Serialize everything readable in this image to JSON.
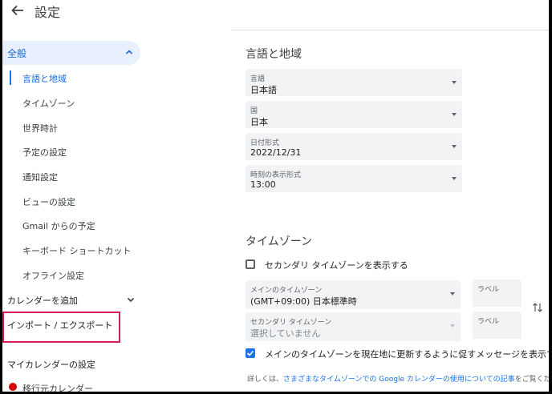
{
  "header": {
    "title": "設定",
    "back_icon": "arrow-back-icon"
  },
  "sidebar": {
    "general_label": "全般",
    "items": [
      {
        "label": "言語と地域",
        "active": true
      },
      {
        "label": "タイムゾーン"
      },
      {
        "label": "世界時計"
      },
      {
        "label": "予定の設定"
      },
      {
        "label": "通知設定"
      },
      {
        "label": "ビューの設定"
      },
      {
        "label": "Gmail からの予定"
      },
      {
        "label": "キーボード ショートカット"
      },
      {
        "label": "オフライン設定"
      }
    ],
    "add_calendar": "カレンダーを追加",
    "import_export": "インポート / エクスポート",
    "my_calendars": "マイカレンダーの設定",
    "migrate_calendar": "移行元カレンダー",
    "accent_color": "#1a73e8",
    "highlight_color": "#d81b60",
    "calendar_dot_color": "#d50000"
  },
  "language_region": {
    "title": "言語と地域",
    "fields": [
      {
        "label": "言語",
        "value": "日本語"
      },
      {
        "label": "国",
        "value": "日本"
      },
      {
        "label": "日付形式",
        "value": "2022/12/31"
      },
      {
        "label": "時刻の表示形式",
        "value": "13:00"
      }
    ]
  },
  "timezone": {
    "title": "タイムゾーン",
    "secondary_checkbox": {
      "label": "セカンダリ タイムゾーンを表示する",
      "checked": false
    },
    "primary": {
      "label": "メインのタイムゾーン",
      "value": "(GMT+09:00) 日本標準時",
      "label_field": "ラベル"
    },
    "secondary": {
      "label": "セカンダリ タイムゾーン",
      "value": "選択していません",
      "label_field": "ラベル"
    },
    "update_checkbox": {
      "label": "メインのタイムゾーンを現在地に更新するように促すメッセージを表示す",
      "checked": true
    },
    "detail_prefix": "詳しくは、",
    "detail_link": "さまざまなタイムゾーンでの Google カレンダーの使用についての記事",
    "detail_suffix": "をご覧くだ"
  }
}
